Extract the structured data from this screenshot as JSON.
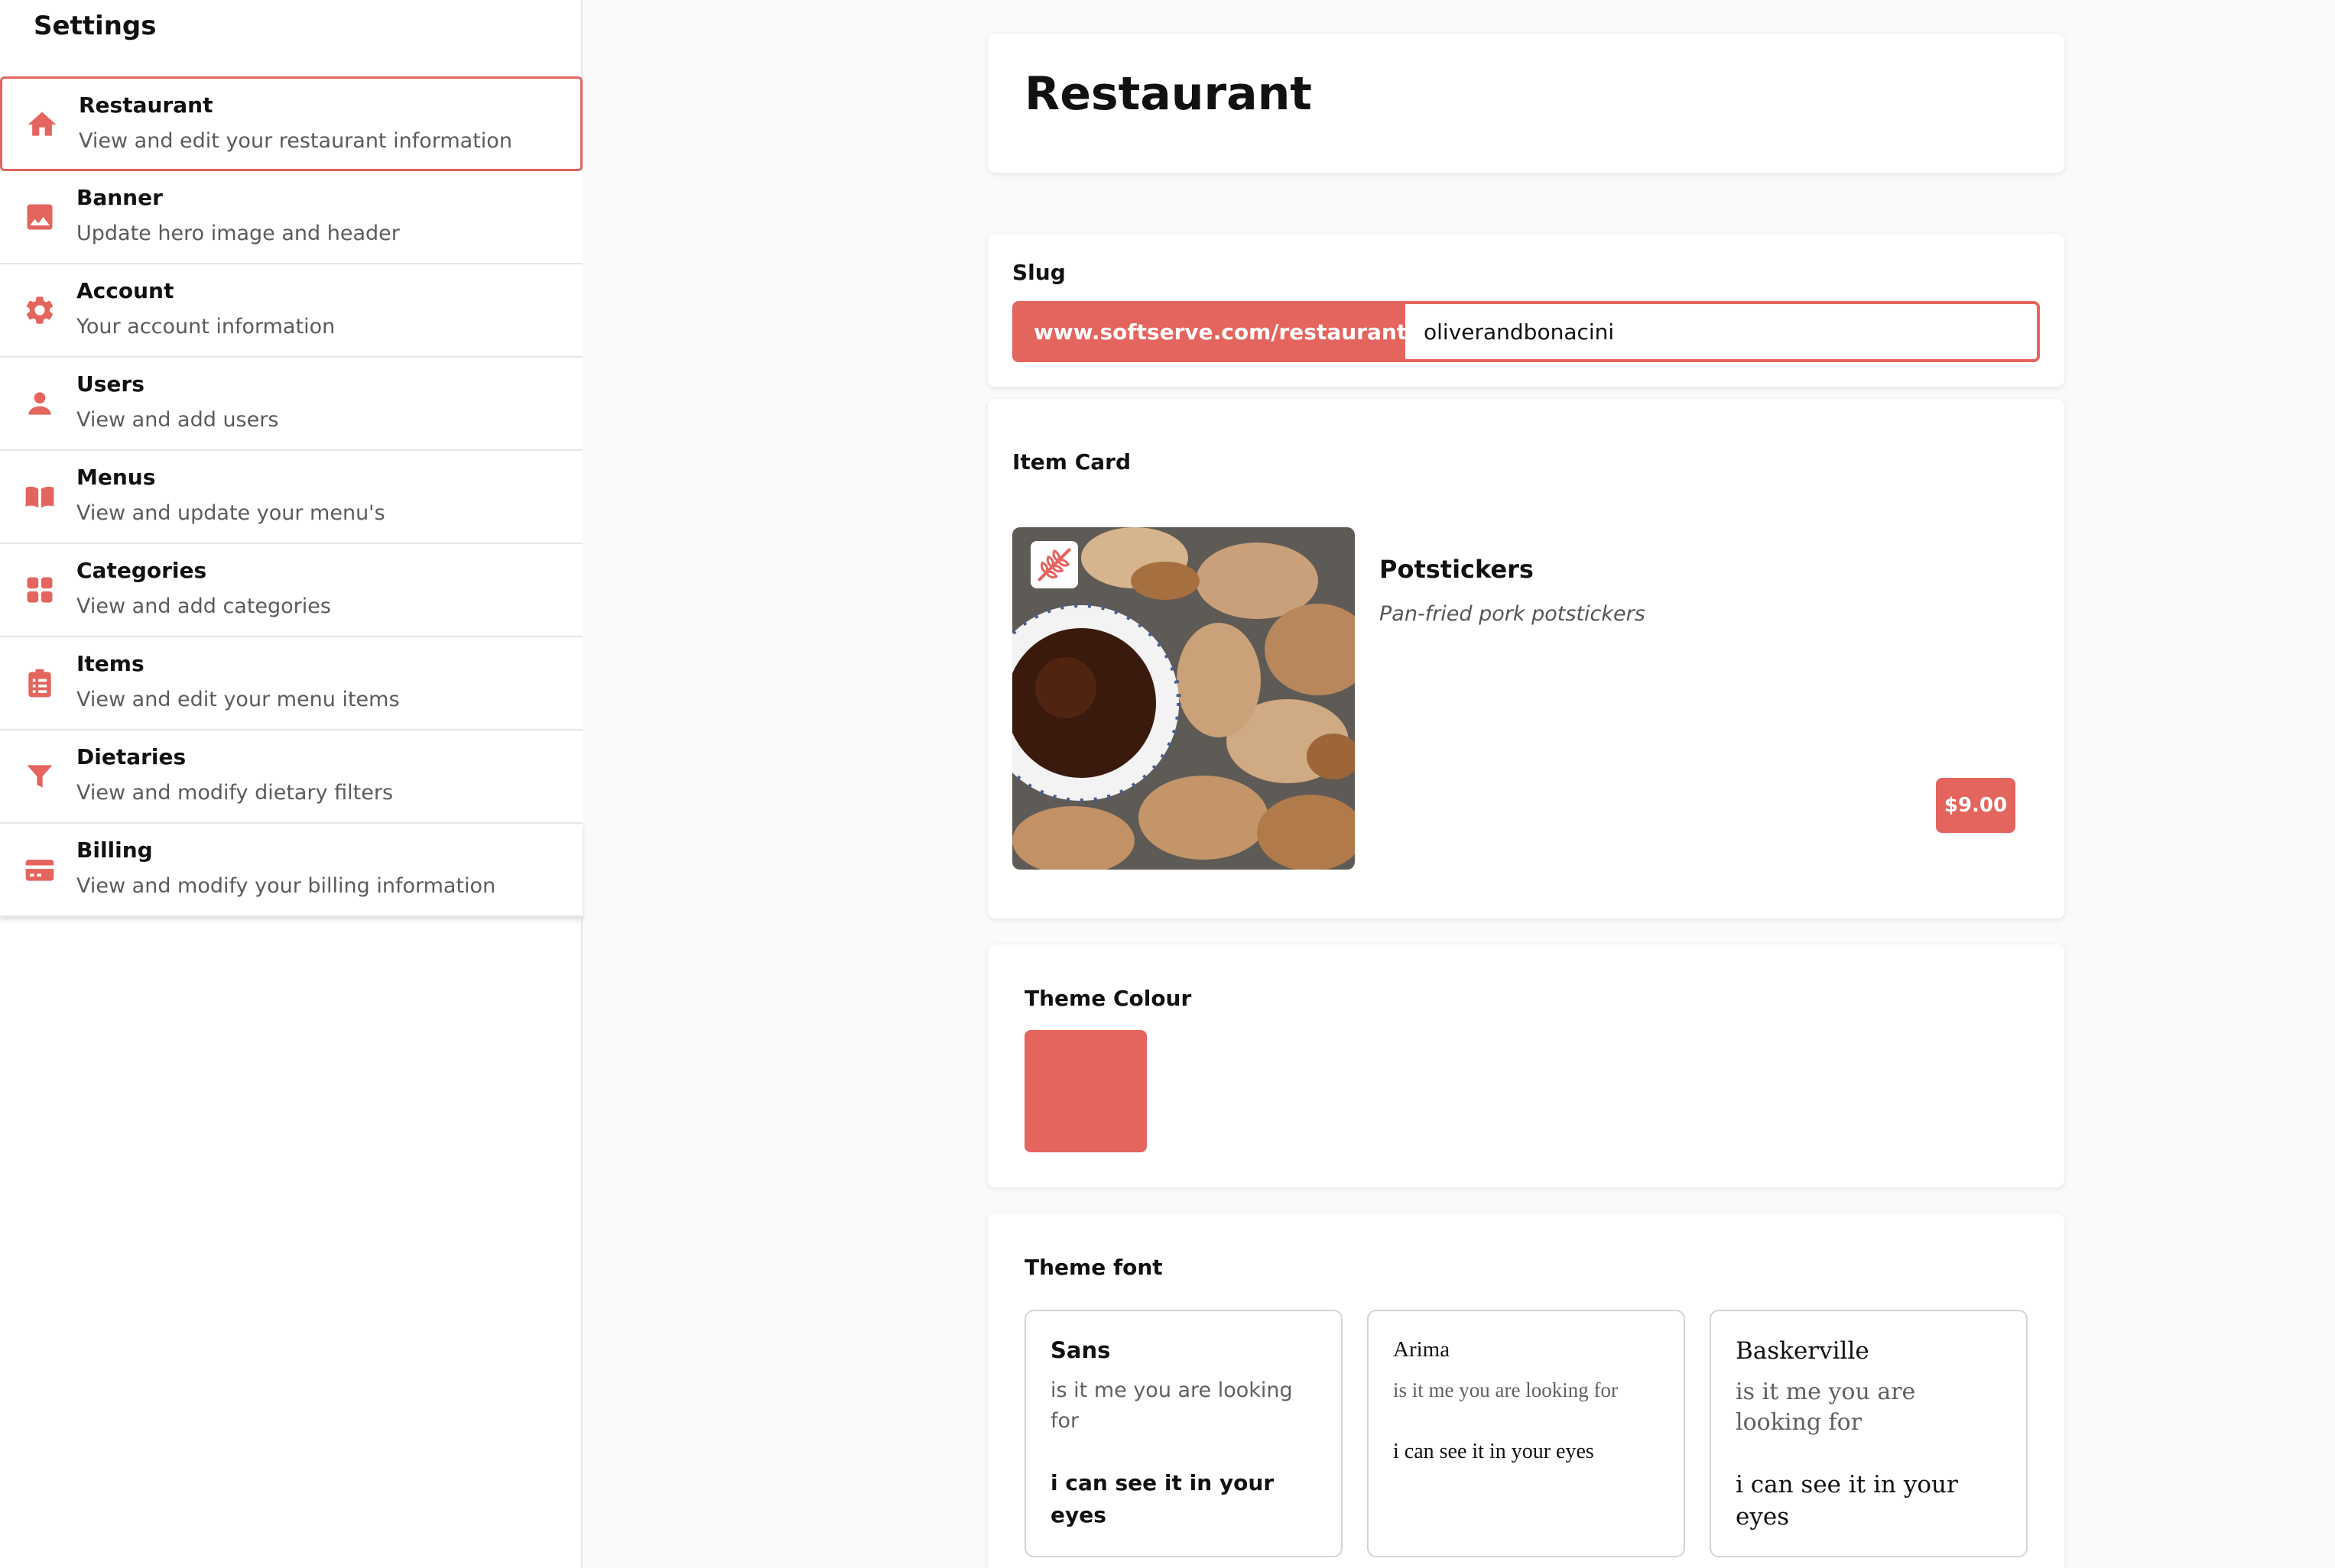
{
  "sidebar": {
    "title": "Settings",
    "items": [
      {
        "label": "Restaurant",
        "desc": "View and edit your restaurant information",
        "icon": "home-icon"
      },
      {
        "label": "Banner",
        "desc": "Update hero image and header",
        "icon": "image-icon"
      },
      {
        "label": "Account",
        "desc": "Your account information",
        "icon": "gear-icon"
      },
      {
        "label": "Users",
        "desc": "View and add users",
        "icon": "user-icon"
      },
      {
        "label": "Menus",
        "desc": "View and update your menu's",
        "icon": "book-icon"
      },
      {
        "label": "Categories",
        "desc": "View and add categories",
        "icon": "grid-icon"
      },
      {
        "label": "Items",
        "desc": "View and edit your menu items",
        "icon": "clipboard-list-icon"
      },
      {
        "label": "Dietaries",
        "desc": "View and modify dietary filters",
        "icon": "filter-icon"
      },
      {
        "label": "Billing",
        "desc": "View and modify your billing information",
        "icon": "credit-card-icon"
      }
    ]
  },
  "main": {
    "title": "Restaurant",
    "slug": {
      "label": "Slug",
      "prefix": "www.softserve.com/restaurants/",
      "value": "oliverandbonacini"
    },
    "item_card": {
      "label": "Item Card",
      "name": "Potstickers",
      "description": "Pan-fried pork potstickers",
      "price": "$9.00",
      "badge_icon": "wheat-icon"
    },
    "theme_colour": {
      "label": "Theme Colour",
      "value": "#e4645e"
    },
    "theme_font": {
      "label": "Theme font",
      "options": [
        {
          "name": "Sans",
          "sample": "is it me you are looking for",
          "line2": "i can see it in your eyes"
        },
        {
          "name": "Arima",
          "sample": "is it me you are looking for",
          "line2": "i can see it in your eyes"
        },
        {
          "name": "Baskerville",
          "sample": "is it me you are looking for",
          "line2": "i can see it in your eyes"
        }
      ]
    }
  },
  "colors": {
    "accent": "#e4645e",
    "background": "#fafafa",
    "card": "#ffffff"
  }
}
